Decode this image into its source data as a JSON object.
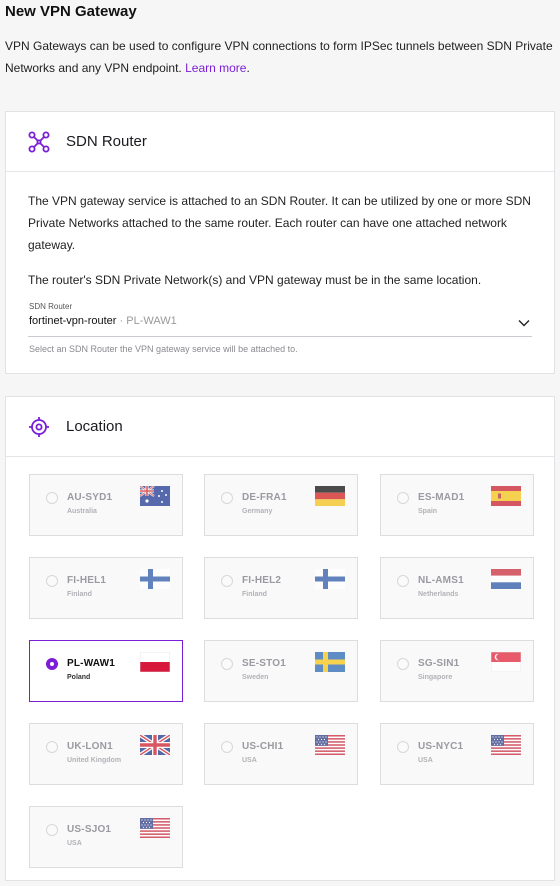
{
  "page": {
    "title": "New VPN Gateway",
    "intro_text": "VPN Gateways can be used to configure VPN connections to form IPSec tunnels between SDN Private Networks and any VPN endpoint.",
    "learn_more": "Learn more"
  },
  "sdn_router": {
    "title": "SDN Router",
    "description_1": "The VPN gateway service is attached to an SDN Router. It can be utilized by one or more SDN Private Networks attached to the same router. Each router can have one attached network gateway.",
    "description_2": "The router's SDN Private Network(s) and VPN gateway must be in the same location.",
    "select_label": "SDN Router",
    "select_value": "fortinet-vpn-router",
    "select_location": "PL-WAW1",
    "select_separator": "·",
    "helper_text": "Select an SDN Router the VPN gateway service will be attached to."
  },
  "location": {
    "title": "Location",
    "selected": "PL-WAW1",
    "tiles": [
      {
        "code": "AU-SYD1",
        "country": "Australia",
        "flag": "au-flag-icon",
        "state": "disabled"
      },
      {
        "code": "DE-FRA1",
        "country": "Germany",
        "flag": "de-flag-icon",
        "state": "disabled"
      },
      {
        "code": "ES-MAD1",
        "country": "Spain",
        "flag": "es-flag-icon",
        "state": "disabled"
      },
      {
        "code": "FI-HEL1",
        "country": "Finland",
        "flag": "fi-flag-icon",
        "state": "disabled"
      },
      {
        "code": "FI-HEL2",
        "country": "Finland",
        "flag": "fi-flag-icon",
        "state": "disabled"
      },
      {
        "code": "NL-AMS1",
        "country": "Netherlands",
        "flag": "nl-flag-icon",
        "state": "disabled"
      },
      {
        "code": "PL-WAW1",
        "country": "Poland",
        "flag": "pl-flag-icon",
        "state": "selected"
      },
      {
        "code": "SE-STO1",
        "country": "Sweden",
        "flag": "se-flag-icon",
        "state": "disabled"
      },
      {
        "code": "SG-SIN1",
        "country": "Singapore",
        "flag": "sg-flag-icon",
        "state": "disabled"
      },
      {
        "code": "UK-LON1",
        "country": "United Kingdom",
        "flag": "uk-flag-icon",
        "state": "disabled"
      },
      {
        "code": "US-CHI1",
        "country": "USA",
        "flag": "us-flag-icon",
        "state": "disabled"
      },
      {
        "code": "US-NYC1",
        "country": "USA",
        "flag": "us-flag-icon",
        "state": "disabled"
      },
      {
        "code": "US-SJO1",
        "country": "USA",
        "flag": "us-flag-icon",
        "state": "disabled"
      }
    ]
  },
  "colors": {
    "accent": "#7b1fd6",
    "link": "#7b1fd6",
    "background": "#f6f6f7"
  }
}
